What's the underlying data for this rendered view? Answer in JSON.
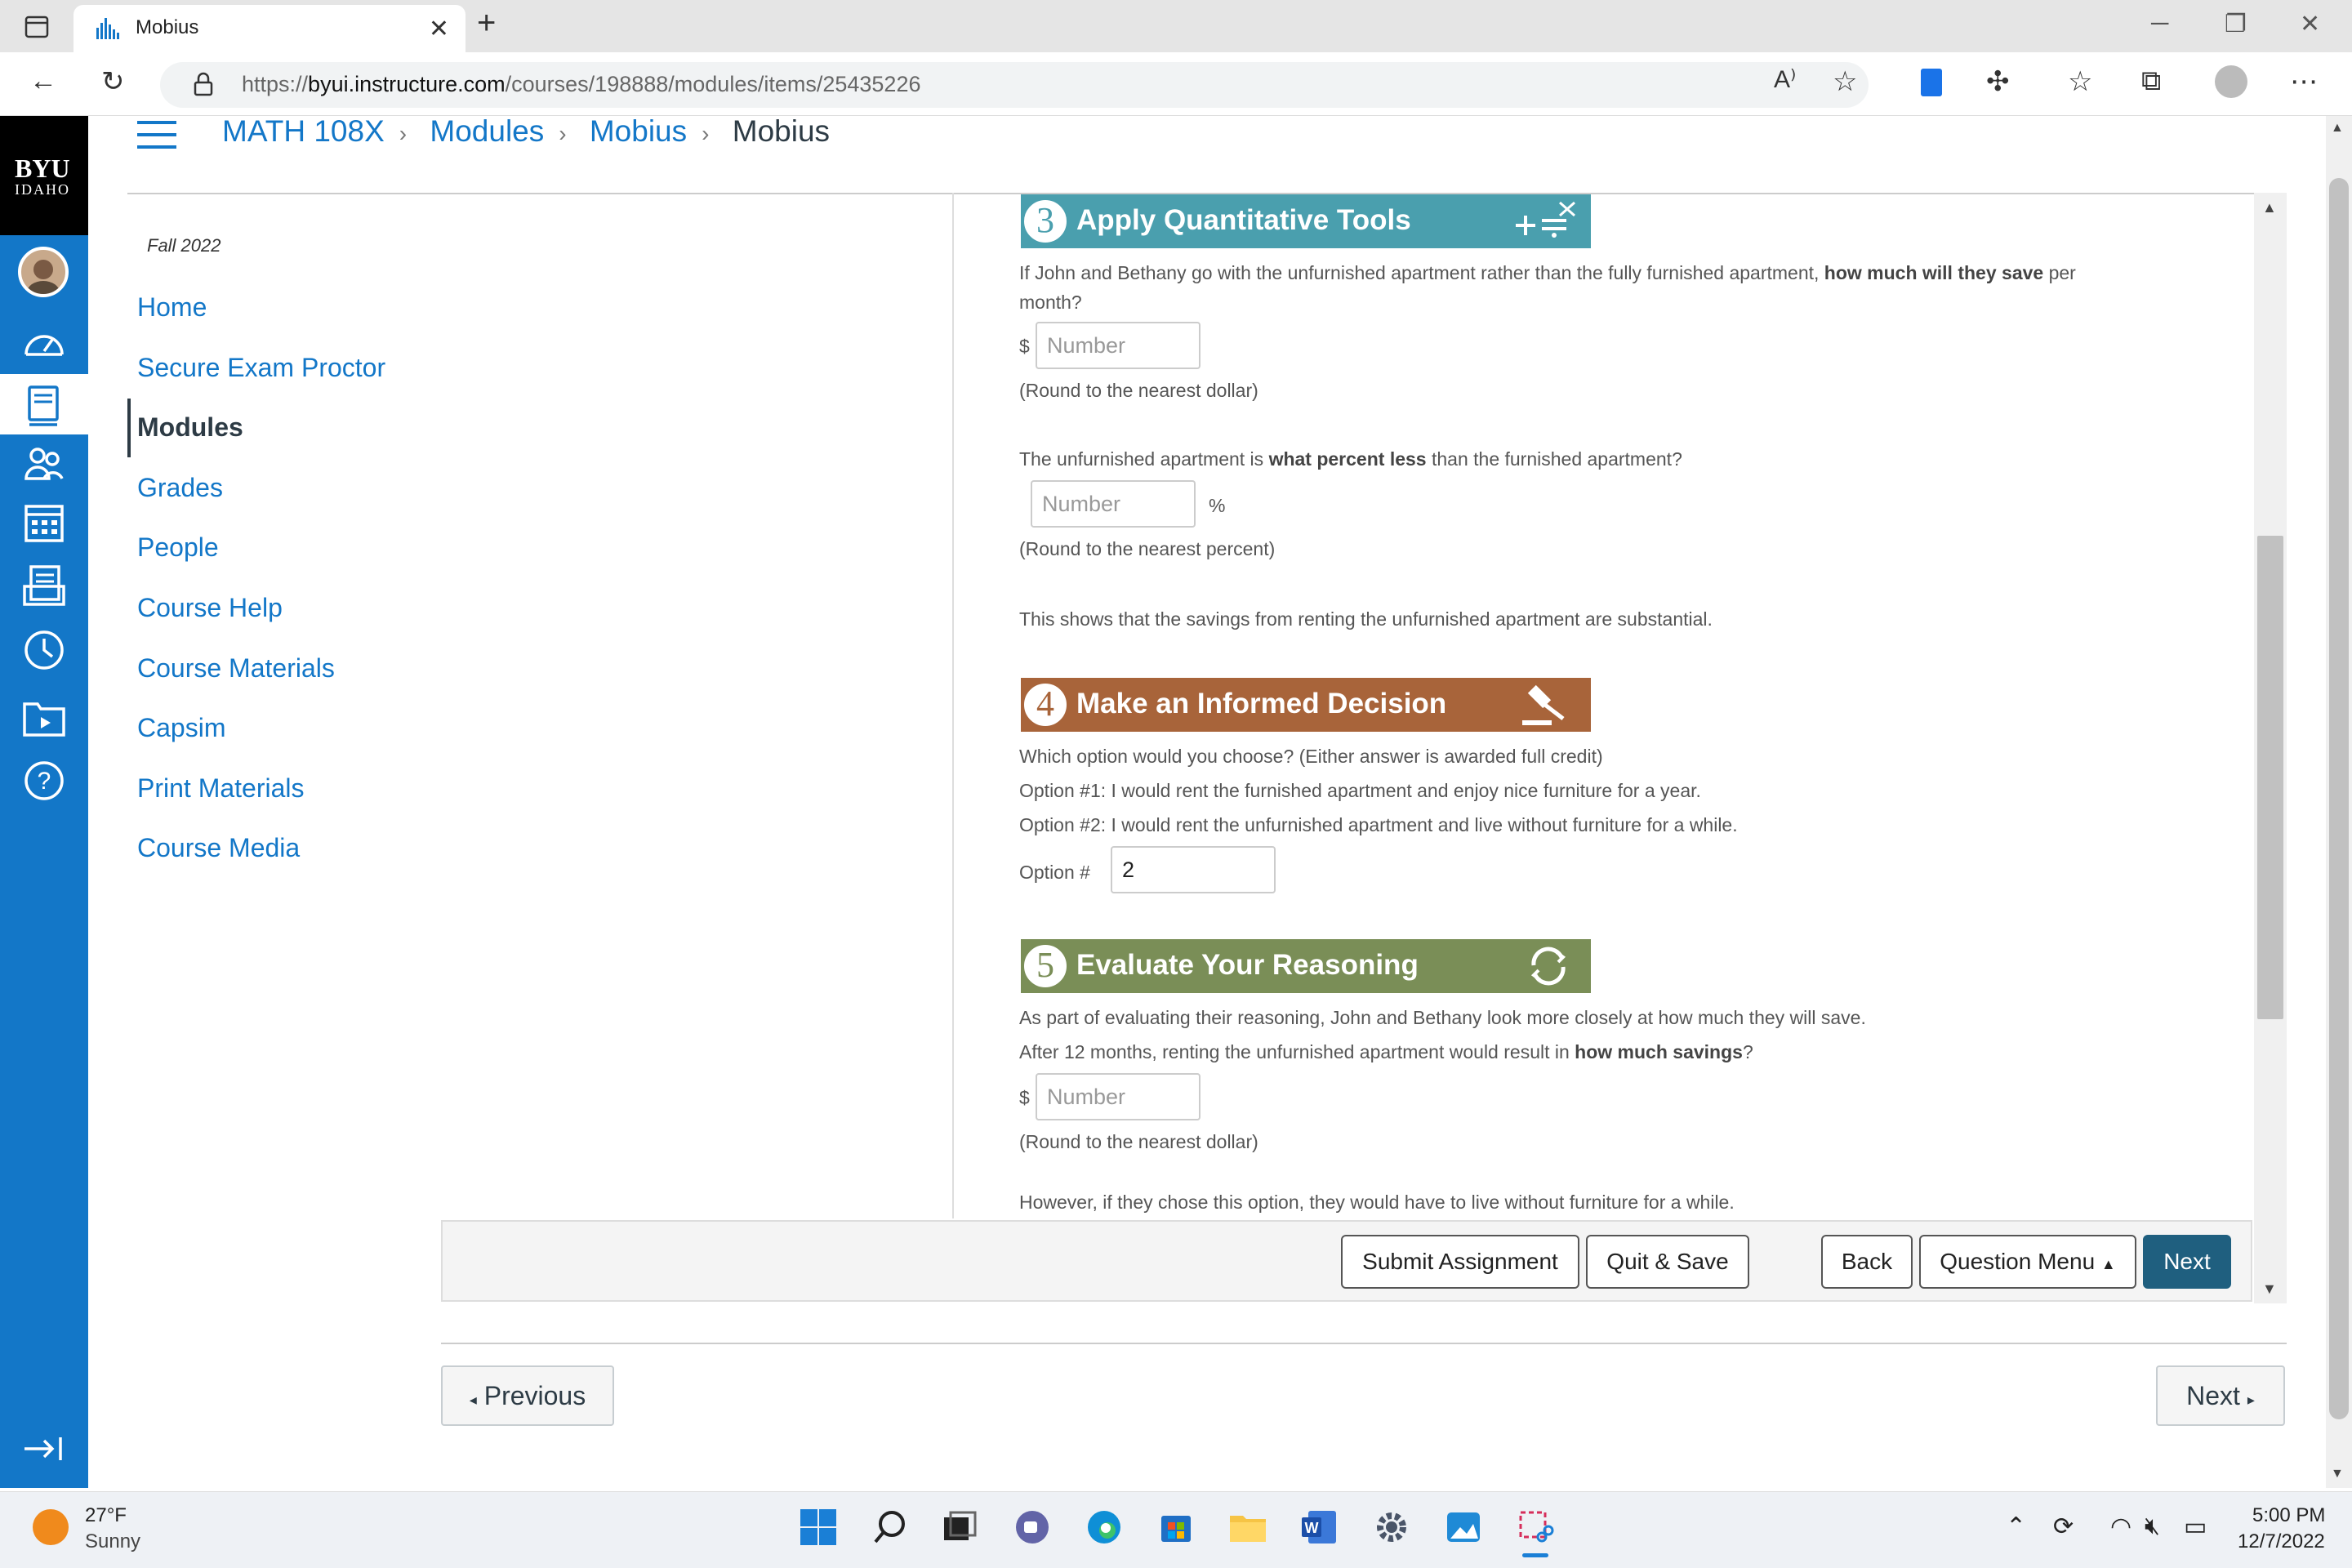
{
  "browser": {
    "tab_title": "Mobius",
    "url_prefix": "https://",
    "url_host": "byui.instructure.com",
    "url_path": "/courses/198888/modules/items/25435226"
  },
  "global_nav": {
    "logo_top": "BYU",
    "logo_bottom": "IDAHO",
    "items": [
      "account",
      "dashboard",
      "courses",
      "groups",
      "calendar",
      "inbox",
      "history",
      "studio",
      "help"
    ]
  },
  "breadcrumb": [
    "MATH 108X",
    "Modules",
    "Mobius",
    "Mobius"
  ],
  "course_nav": {
    "term": "Fall 2022",
    "items": [
      "Home",
      "Secure Exam Proctor",
      "Modules",
      "Grades",
      "People",
      "Course Help",
      "Course Materials",
      "Capsim",
      "Print Materials",
      "Course Media"
    ],
    "active": "Modules"
  },
  "content": {
    "step3": {
      "num": "3",
      "title": "Apply Quantitative Tools",
      "color": "#4a9fae",
      "q1_pre": "If John and Bethany go with the unfurnished apartment rather than the fully furnished apartment,",
      "q1_bold": "how much will they save",
      "q1_post": "per",
      "q1_line2": "month?",
      "currency": "$",
      "input1_placeholder": "Number",
      "round1": "(Round to the nearest dollar)",
      "q2_pre": "The unfurnished apartment is",
      "q2_bold": "what percent less",
      "q2_post": "than the furnished apartment?",
      "input2_placeholder": "Number",
      "percent": "%",
      "round2": "(Round to the nearest percent)",
      "note": "This shows that the savings from renting the unfurnished apartment are substantial."
    },
    "step4": {
      "num": "4",
      "title": "Make an Informed Decision",
      "color": "#a8643a",
      "q": "Which option would you choose? (Either answer is awarded full credit)",
      "opt1": "Option #1: I would rent the furnished apartment and enjoy nice furniture for a year.",
      "opt2": "Option #2: I would rent the unfurnished apartment and live without furniture for a while.",
      "option_label": "Option #",
      "option_value": "2"
    },
    "step5": {
      "num": "5",
      "title": "Evaluate Your Reasoning",
      "color": "#7a8e57",
      "p1": "As part of evaluating their reasoning, John and Bethany look more closely at how much they will save.",
      "p2_pre": "After 12 months, renting the unfurnished apartment would result in",
      "p2_bold": "how much savings",
      "p2_post": "?",
      "currency": "$",
      "input_placeholder": "Number",
      "round": "(Round to the nearest dollar)",
      "cut_text": "However, if they chose this option, they would have to live without furniture for a while."
    }
  },
  "actions": {
    "submit": "Submit Assignment",
    "quit": "Quit & Save",
    "back": "Back",
    "question_menu": "Question Menu",
    "next": "Next"
  },
  "module_nav": {
    "previous": "Previous",
    "next": "Next"
  },
  "taskbar": {
    "temp": "27°F",
    "condition": "Sunny",
    "time": "5:00 PM",
    "date": "12/7/2022"
  },
  "colors": {
    "canvas_blue": "#1377c8",
    "next_button": "#1f5f7f"
  }
}
